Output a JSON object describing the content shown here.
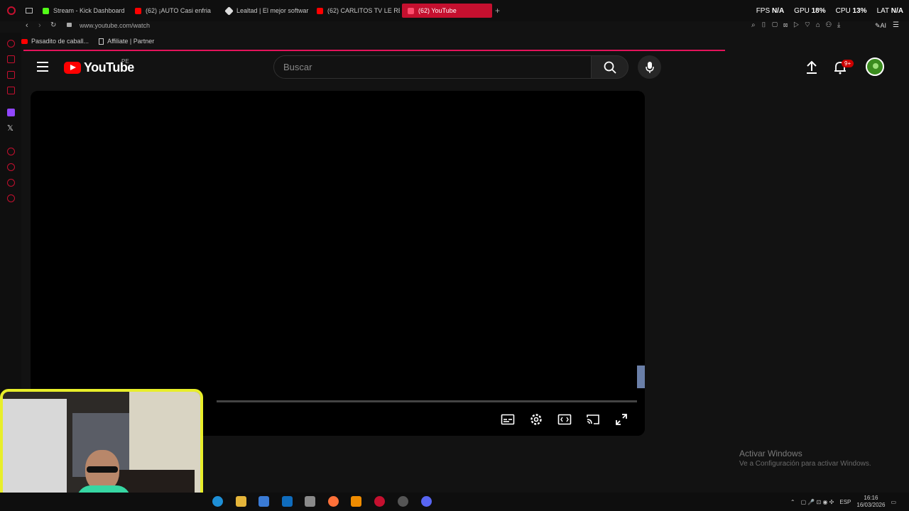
{
  "browser": {
    "tabs": [
      {
        "label": "Stream - Kick Dashboard",
        "color": "#53fc18"
      },
      {
        "label": "(62) ¡AUTO Casi enfria",
        "color": "#ff0000"
      },
      {
        "label": "Lealtad | El mejor softwar",
        "color": "#dddddd"
      },
      {
        "label": "(62) CARLITOS TV LE RES",
        "color": "#ff0000"
      },
      {
        "label": "(62) YouTube",
        "color": "#ff0000"
      }
    ],
    "url": "www.youtube.com/watch",
    "bookmarks": [
      "Pasadito de caball...",
      "Affiliate | Partner"
    ],
    "hud": {
      "fps_label": "FPS",
      "fps": "N/A",
      "gpu_label": "GPU",
      "gpu": "18%",
      "cpu_label": "CPU",
      "cpu": "13%",
      "lat_label": "LAT",
      "lat": "N/A"
    },
    "accent": "#c5102f"
  },
  "youtube": {
    "logo": "YouTube",
    "country": "PE",
    "search_placeholder": "Buscar",
    "notifications_badge": "9+"
  },
  "watermark": {
    "title": "Activar Windows",
    "subtitle": "Ve a Configuración para activar Windows."
  },
  "taskbar": {
    "language": "ESP",
    "time": "16:16",
    "date": "16/03/2026"
  }
}
